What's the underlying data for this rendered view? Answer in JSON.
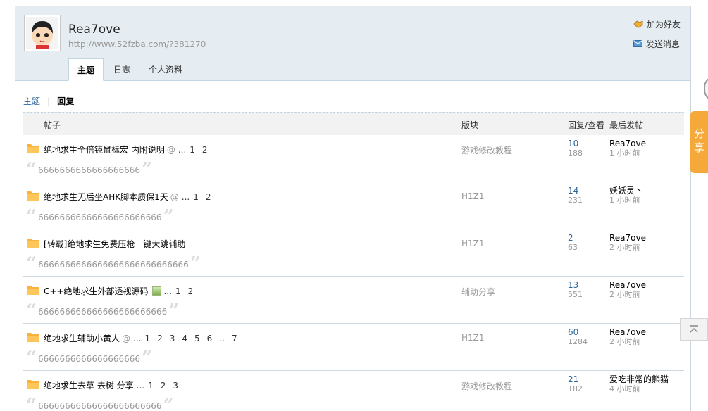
{
  "profile": {
    "username": "Rea7ove",
    "url": "http://www.52fzba.com/?381270",
    "add_friend": "加为好友",
    "send_message": "发送消息"
  },
  "tabs": [
    {
      "label": "主题",
      "active": true
    },
    {
      "label": "日志",
      "active": false
    },
    {
      "label": "个人资料",
      "active": false
    }
  ],
  "subnav": {
    "topics": "主题",
    "replies": "回复"
  },
  "columns": {
    "post": "帖子",
    "forum": "版块",
    "replies_views": "回复/查看",
    "last_post": "最后发帖"
  },
  "posts": [
    {
      "title": "绝地求生全倍镜鼠标宏 内附说明",
      "attach": true,
      "image": false,
      "pages": [
        "1",
        "2"
      ],
      "forum": "游戏修改教程",
      "replies": "10",
      "views": "188",
      "last_by": "Rea7ove",
      "last_time": "1 小时前",
      "reply": "6666666666666666666"
    },
    {
      "title": "绝地求生无后坐AHK脚本质保1天",
      "attach": true,
      "image": false,
      "pages": [
        "1",
        "2"
      ],
      "forum": "H1Z1",
      "replies": "14",
      "views": "231",
      "last_by": "妖妖灵丶",
      "last_time": "1 小时前",
      "reply": "66666666666666666666666"
    },
    {
      "title": "[转载]绝地求生免费压枪一键大跳辅助",
      "attach": false,
      "image": false,
      "pages": [],
      "forum": "H1Z1",
      "replies": "2",
      "views": "63",
      "last_by": "Rea7ove",
      "last_time": "2 小时前",
      "reply": "6666666666666666666666666666"
    },
    {
      "title": "C++绝地求生外部透视源码",
      "attach": false,
      "image": true,
      "pages": [
        "1",
        "2"
      ],
      "forum": "辅助分享",
      "replies": "13",
      "views": "551",
      "last_by": "Rea7ove",
      "last_time": "2 小时前",
      "reply": "666666666666666666666666"
    },
    {
      "title": "绝地求生辅助小黄人",
      "attach": true,
      "image": false,
      "pages": [
        "1",
        "2",
        "3",
        "4",
        "5",
        "6",
        "..",
        "7"
      ],
      "forum": "H1Z1",
      "replies": "60",
      "views": "1284",
      "last_by": "Rea7ove",
      "last_time": "2 小时前",
      "reply": "6666666666666666666"
    },
    {
      "title": "绝地求生去草 去树 分享",
      "attach": false,
      "image": false,
      "pages": [
        "1",
        "2",
        "3"
      ],
      "forum": "游戏修改教程",
      "replies": "21",
      "views": "182",
      "last_by": "爱吃非常的熊猫",
      "last_time": "4 小时前",
      "reply": "66666666666666666666666"
    }
  ],
  "share": "分享",
  "colors": {
    "header_bg": "#e5edf2",
    "link": "#336699",
    "folder": "#f8b33d",
    "share_bg": "#f5a93a"
  }
}
